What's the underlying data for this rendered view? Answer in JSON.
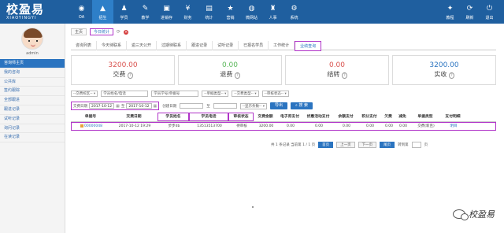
{
  "brand": {
    "name": "校盈易",
    "sub": "XIAOYINGYI"
  },
  "nav": [
    {
      "label": "OA",
      "icon": "oa-icon",
      "glyph": "◉"
    },
    {
      "label": "招生",
      "icon": "enroll-icon",
      "glyph": "▲"
    },
    {
      "label": "学员",
      "icon": "student-icon",
      "glyph": "♟"
    },
    {
      "label": "教学",
      "icon": "teaching-icon",
      "glyph": "✎"
    },
    {
      "label": "进销存",
      "icon": "inventory-icon",
      "glyph": "▣"
    },
    {
      "label": "财务",
      "icon": "finance-icon",
      "glyph": "¥"
    },
    {
      "label": "统计",
      "icon": "stats-icon",
      "glyph": "▤"
    },
    {
      "label": "营销",
      "icon": "marketing-icon",
      "glyph": "★"
    },
    {
      "label": "微网站",
      "icon": "website-icon",
      "glyph": "◍"
    },
    {
      "label": "人事",
      "icon": "hr-icon",
      "glyph": "♜"
    },
    {
      "label": "系统",
      "icon": "system-icon",
      "glyph": "⚙"
    }
  ],
  "right_nav": [
    {
      "label": "教程",
      "icon": "tutorial-icon",
      "glyph": "✦"
    },
    {
      "label": "刷新",
      "icon": "refresh-icon",
      "glyph": "⟳"
    },
    {
      "label": "退出",
      "icon": "logout-icon",
      "glyph": "⏻"
    }
  ],
  "sidebar": {
    "user": "admin",
    "items": [
      "咨询师主页",
      "我的咨询",
      "公共库",
      "签约跟踪",
      "全部跟进",
      "跟进记录",
      "试听记录",
      "询问记录",
      "在读记录"
    ]
  },
  "crumbs": {
    "home": "主页",
    "current": "今日统计"
  },
  "subtabs": [
    "咨询列表",
    "今天待联系",
    "逾三天公开",
    "过期待联系",
    "跟进记录",
    "试听记录",
    "已报名学员",
    "工作统计",
    "业绩查询"
  ],
  "cards": [
    {
      "value": "3200.00",
      "label": "交费",
      "color": "#d9534f"
    },
    {
      "value": "0.00",
      "label": "退费",
      "color": "#5cb85c"
    },
    {
      "value": "0.00",
      "label": "结转",
      "color": "#d9534f"
    },
    {
      "value": "3200.00",
      "label": "实收",
      "color": "#2b74c0"
    }
  ],
  "filters": {
    "campus": "--交费校区--",
    "student_ph": "学员姓名/电话",
    "number_ph": "学员学号/单据号",
    "doc_type": "--单据类型--",
    "pay_type": "--交费类型--",
    "audit": "--审核状态--",
    "date_label": "交费日期",
    "date_from": "2017-10-12",
    "date_to_prefix": "至",
    "date_to": "2017-10-12",
    "created_label": "创建日期",
    "to": "至",
    "show": "--显示条数--",
    "export": "导出",
    "search": "搜 索"
  },
  "table": {
    "headers": [
      "单据号",
      "交费日期",
      "学员姓名",
      "学员电话",
      "审核状态",
      "交费金额",
      "电子券支付",
      "优惠活动支付",
      "余额支付",
      "积分支付",
      "欠费",
      "减免",
      "单据类型",
      "支付明细"
    ],
    "rows": [
      [
        "00000048",
        "2017-10-12 19:29",
        "步步db",
        "13513513700",
        "待审核",
        "3200.00",
        "0.00",
        "0.00",
        "0.00",
        "0.00",
        "0.00",
        "0.00",
        "交费(新且)",
        "明目"
      ]
    ]
  },
  "pager": {
    "summary": "共 1 条记录 当前第 1 / 1 页",
    "first": "首页",
    "prev": "上一页",
    "next": "下一页",
    "last": "尾页",
    "jump": "转到第",
    "page": "页"
  },
  "watermark": "校盈易"
}
